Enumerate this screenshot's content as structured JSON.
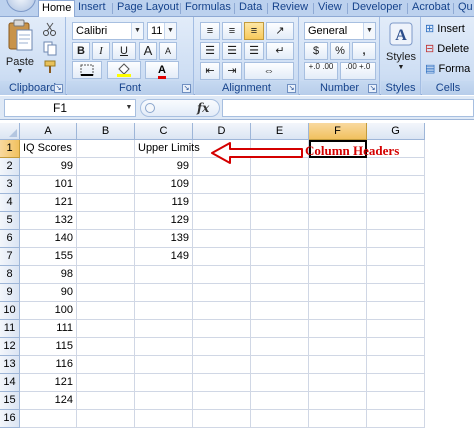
{
  "ribbon": {
    "tabs": [
      "Home",
      "Insert",
      "Page Layout",
      "Formulas",
      "Data",
      "Review",
      "View",
      "Developer",
      "Acrobat",
      "Qu"
    ],
    "active_tab": "Home",
    "clipboard": {
      "label": "Clipboard",
      "paste_label": "Paste"
    },
    "font": {
      "label": "Font",
      "font_name": "Calibri",
      "font_size": "11",
      "bold": "B",
      "italic": "I",
      "underline": "U",
      "grow": "A",
      "shrink": "A",
      "font_color_glyph": "A"
    },
    "alignment": {
      "label": "Alignment"
    },
    "number": {
      "label": "Number",
      "format": "General",
      "currency": "$",
      "percent": "%",
      "comma": ",",
      "inc_decimal": "+.0 .00",
      "dec_decimal": ".00 +.0"
    },
    "styles": {
      "label": "Styles",
      "button": "Styles"
    },
    "cells": {
      "label": "Cells",
      "insert": "Insert",
      "delete": "Delete",
      "format": "Forma"
    }
  },
  "formula_bar": {
    "name_box": "F1",
    "fx": "fx",
    "content": ""
  },
  "sheet": {
    "columns": [
      "A",
      "B",
      "C",
      "D",
      "E",
      "F",
      "G"
    ],
    "selected_column": "F",
    "rows": [
      "1",
      "2",
      "3",
      "4",
      "5",
      "6",
      "7",
      "8",
      "9",
      "10",
      "11",
      "12",
      "13",
      "14",
      "15",
      "16"
    ],
    "selected_row": "1",
    "column_a": [
      "IQ Scores",
      "99",
      "101",
      "121",
      "132",
      "140",
      "155",
      "98",
      "90",
      "100",
      "111",
      "115",
      "116",
      "121",
      "124",
      ""
    ],
    "column_c": [
      "Upper Limits",
      "99",
      "109",
      "119",
      "129",
      "139",
      "149",
      "",
      "",
      "",
      "",
      "",
      "",
      "",
      "",
      ""
    ]
  },
  "annotation": {
    "text": "Column Headers",
    "color": "#d40000"
  },
  "colors": {
    "ribbon_bg": "#cfdff4",
    "tab_text": "#15428b",
    "selection": "#f1c15f",
    "gridline": "#d0d7e5",
    "annotation_red": "#d40000"
  }
}
